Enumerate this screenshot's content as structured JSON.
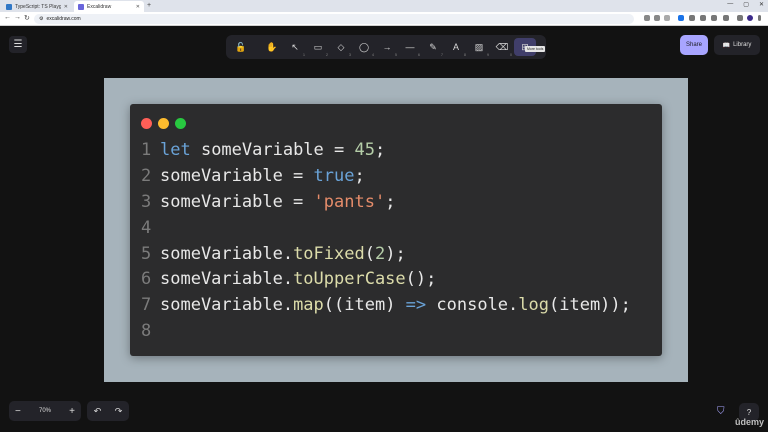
{
  "browser": {
    "tabs": [
      {
        "title": "TypeScript: TS Playground"
      },
      {
        "title": "Excalidraw"
      }
    ],
    "url": "excalidraw.com"
  },
  "toolbar": {
    "tools": [
      {
        "name": "lock",
        "icon": "lock-icon",
        "glyph": "🔓",
        "key": ""
      },
      {
        "name": "hand",
        "icon": "hand-icon",
        "glyph": "✋",
        "key": ""
      },
      {
        "name": "selection",
        "icon": "pointer-icon",
        "glyph": "↖",
        "key": "1"
      },
      {
        "name": "rectangle",
        "icon": "rectangle-icon",
        "glyph": "▭",
        "key": "2"
      },
      {
        "name": "diamond",
        "icon": "diamond-icon",
        "glyph": "◇",
        "key": "3"
      },
      {
        "name": "ellipse",
        "icon": "ellipse-icon",
        "glyph": "◯",
        "key": "4"
      },
      {
        "name": "arrow",
        "icon": "arrow-icon",
        "glyph": "→",
        "key": "5"
      },
      {
        "name": "line",
        "icon": "line-icon",
        "glyph": "—",
        "key": "6"
      },
      {
        "name": "draw",
        "icon": "pencil-icon",
        "glyph": "✎",
        "key": "7"
      },
      {
        "name": "text",
        "icon": "text-icon",
        "glyph": "A",
        "key": "8"
      },
      {
        "name": "image",
        "icon": "image-icon",
        "glyph": "▨",
        "key": "9"
      },
      {
        "name": "eraser",
        "icon": "eraser-icon",
        "glyph": "⌫",
        "key": "0"
      },
      {
        "name": "more",
        "icon": "more-tools-icon",
        "glyph": "⊞",
        "key": ""
      }
    ],
    "tooltip": "More tools",
    "share_label": "Share",
    "library_label": "Library"
  },
  "code_block": {
    "lines": [
      {
        "n": "1",
        "tokens": [
          [
            "kw",
            "let"
          ],
          [
            "t",
            " someVariable = "
          ],
          [
            "num",
            "45"
          ],
          [
            "t",
            ";"
          ]
        ]
      },
      {
        "n": "2",
        "tokens": [
          [
            "t",
            "someVariable = "
          ],
          [
            "bool",
            "true"
          ],
          [
            "t",
            ";"
          ]
        ]
      },
      {
        "n": "3",
        "tokens": [
          [
            "t",
            "someVariable = "
          ],
          [
            "str",
            "'pants'"
          ],
          [
            "t",
            ";"
          ]
        ]
      },
      {
        "n": "4",
        "tokens": []
      },
      {
        "n": "5",
        "tokens": [
          [
            "t",
            "someVariable."
          ],
          [
            "fn",
            "toFixed"
          ],
          [
            "t",
            "("
          ],
          [
            "num",
            "2"
          ],
          [
            "t",
            ");"
          ]
        ]
      },
      {
        "n": "6",
        "tokens": [
          [
            "t",
            "someVariable."
          ],
          [
            "fn",
            "toUpperCase"
          ],
          [
            "t",
            "();"
          ]
        ]
      },
      {
        "n": "7",
        "tokens": [
          [
            "t",
            "someVariable."
          ],
          [
            "fn",
            "map"
          ],
          [
            "t",
            "((item) "
          ],
          [
            "op",
            "=>"
          ],
          [
            "t",
            " console."
          ],
          [
            "fn",
            "log"
          ],
          [
            "t",
            "(item));"
          ]
        ]
      },
      {
        "n": "8",
        "tokens": []
      }
    ]
  },
  "bottom": {
    "zoom_out": "−",
    "zoom_level": "70%",
    "zoom_in": "+",
    "undo": "↶",
    "redo": "↷",
    "help": "?",
    "watermark": "ûdemy"
  },
  "colors": {
    "accent": "#a8a5ff",
    "canvas_bg": "#121212",
    "frame_bg": "#a6b3bb",
    "code_bg": "#2c2c2d"
  }
}
